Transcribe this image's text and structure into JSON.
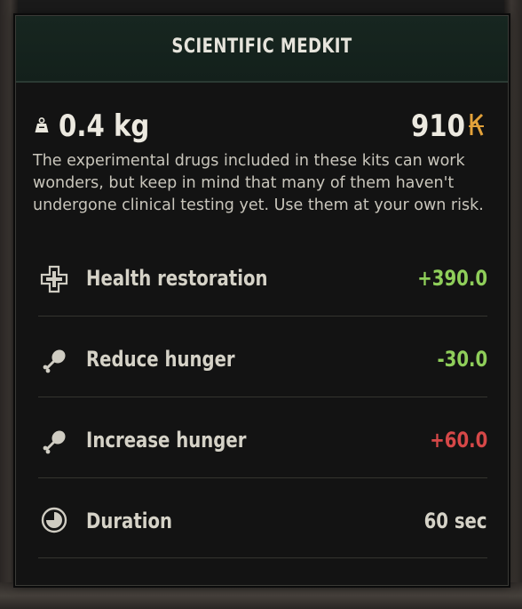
{
  "item": {
    "title": "SCIENTIFIC MEDKIT",
    "weight": "0.4 kg",
    "price": "910",
    "weight_icon": "weight-icon",
    "currency_icon": "currency-icon",
    "description": "The experimental drugs included in these kits can work wonders, but keep in mind that many of them haven't undergone clinical testing yet. Use them at your own risk."
  },
  "stats": [
    {
      "label": "Health restoration",
      "value": "+390.0",
      "icon": "health-cross-icon",
      "color": "#8fce5a"
    },
    {
      "label": "Reduce hunger",
      "value": "-30.0",
      "icon": "drumstick-icon",
      "color": "#8fce5a"
    },
    {
      "label": "Increase hunger",
      "value": "+60.0",
      "icon": "drumstick-icon",
      "color": "#d64848"
    },
    {
      "label": "Duration",
      "value": "60 sec",
      "icon": "timer-icon",
      "color": "#d5d2c7"
    }
  ],
  "colors": {
    "header_bg": "#172620",
    "panel_bg": "#131313",
    "text": "#ece9e0",
    "positive": "#8fce5a",
    "negative": "#d64848",
    "currency": "#e3a23a"
  }
}
